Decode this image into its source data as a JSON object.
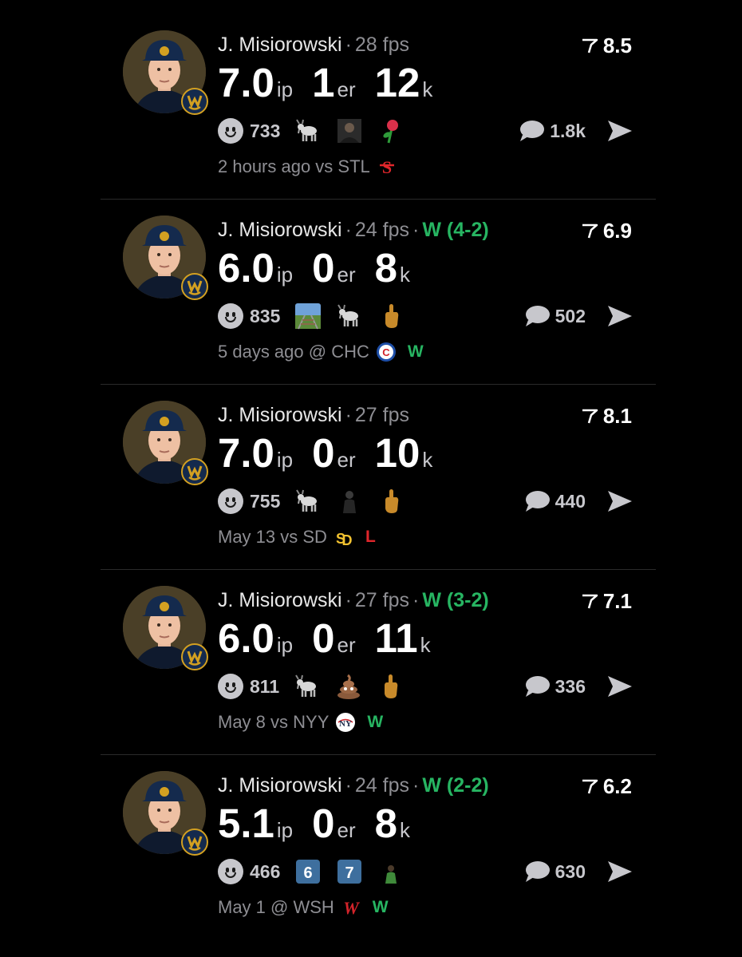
{
  "colors": {
    "background": "#000000",
    "win": "#27b562",
    "loss": "#e0262b",
    "muted": "#8e8e93",
    "avatar_bg": "#4a3f27"
  },
  "icons": {
    "avatar": "player-headshot",
    "badge": "brewers-logo-badge",
    "score": "flag-icon",
    "reaction": "smiley-face-icon",
    "comment": "speech-bubble-icon",
    "share": "send-arrow-icon"
  },
  "posts": [
    {
      "player": "J. Misiorowski",
      "fps": "28 fps",
      "result": "",
      "score": "8.5",
      "ip": "7.0",
      "ip_unit": "ip",
      "er": "1",
      "er_unit": "er",
      "k": "12",
      "k_unit": "k",
      "reactions": "733",
      "emojis": [
        "goat",
        "person-dark",
        "rose"
      ],
      "comments": "1.8k",
      "time": "2 hours ago vs STL",
      "team_logo": "cardinals-logo",
      "outcome": ""
    },
    {
      "player": "J. Misiorowski",
      "fps": "24 fps",
      "result": "W (4-2)",
      "score": "6.9",
      "ip": "6.0",
      "ip_unit": "ip",
      "er": "0",
      "er_unit": "er",
      "k": "8",
      "k_unit": "k",
      "reactions": "835",
      "emojis": [
        "railway-track",
        "goat",
        "middle-finger"
      ],
      "comments": "502",
      "time": "5 days ago @ CHC",
      "team_logo": "cubs-logo",
      "outcome": "W"
    },
    {
      "player": "J. Misiorowski",
      "fps": "27 fps",
      "result": "",
      "score": "8.1",
      "ip": "7.0",
      "ip_unit": "ip",
      "er": "0",
      "er_unit": "er",
      "k": "10",
      "k_unit": "k",
      "reactions": "755",
      "emojis": [
        "goat",
        "person-dark",
        "middle-finger"
      ],
      "comments": "440",
      "time": "May 13 vs SD",
      "team_logo": "padres-logo",
      "outcome": "L"
    },
    {
      "player": "J. Misiorowski",
      "fps": "27 fps",
      "result": "W (3-2)",
      "score": "7.1",
      "ip": "6.0",
      "ip_unit": "ip",
      "er": "0",
      "er_unit": "er",
      "k": "11",
      "k_unit": "k",
      "reactions": "811",
      "emojis": [
        "goat",
        "poop",
        "middle-finger"
      ],
      "comments": "336",
      "time": "May 8 vs NYY",
      "team_logo": "yankees-logo",
      "outcome": "W"
    },
    {
      "player": "J. Misiorowski",
      "fps": "24 fps",
      "result": "W (2-2)",
      "score": "6.2",
      "ip": "5.1",
      "ip_unit": "ip",
      "er": "0",
      "er_unit": "er",
      "k": "8",
      "k_unit": "k",
      "reactions": "466",
      "emojis": [
        "keycap-6",
        "keycap-7",
        "person-green"
      ],
      "emoji_text": {
        "keycap-6": "6",
        "keycap-7": "7"
      },
      "comments": "630",
      "time": "May 1 @ WSH",
      "team_logo": "nationals-logo",
      "outcome": "W"
    }
  ]
}
